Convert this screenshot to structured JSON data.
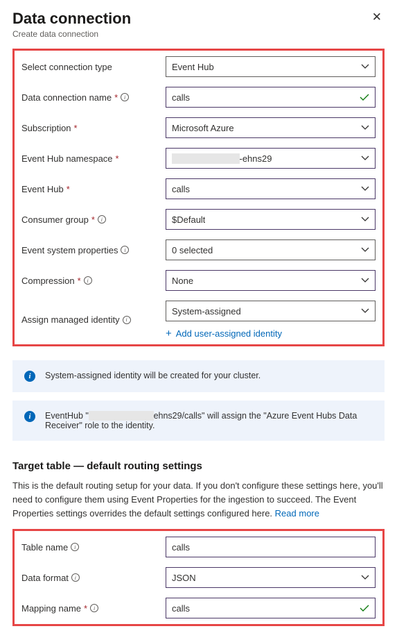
{
  "header": {
    "title": "Data connection",
    "subtitle": "Create data connection"
  },
  "form": {
    "connectionType": {
      "label": "Select connection type",
      "value": "Event Hub"
    },
    "connectionName": {
      "label": "Data connection name",
      "value": "calls"
    },
    "subscription": {
      "label": "Subscription",
      "value": "Microsoft Azure"
    },
    "namespace": {
      "label": "Event Hub namespace",
      "value_prefix": "",
      "value_suffix": "-ehns29"
    },
    "eventHub": {
      "label": "Event Hub",
      "value": "calls"
    },
    "consumerGroup": {
      "label": "Consumer group",
      "value": "$Default"
    },
    "systemProps": {
      "label": "Event system properties",
      "value": "0 selected"
    },
    "compression": {
      "label": "Compression",
      "value": "None"
    },
    "identity": {
      "label": "Assign managed identity",
      "value": "System-assigned"
    },
    "addIdentity": "Add user-assigned identity"
  },
  "banners": {
    "systemAssigned": "System-assigned identity will be created for your cluster.",
    "eventHubRole_prefix": "EventHub \"",
    "eventHubRole_middle": "ehns29/calls\" will assign the \"Azure Event Hubs Data Receiver\" role to the identity."
  },
  "target": {
    "title": "Target table — default routing settings",
    "desc": "This is the default routing setup for your data. If you don't configure these settings here, you'll need to configure them using Event Properties for the ingestion to succeed. The Event Properties settings overrides the default settings configured here. ",
    "readMore": "Read more",
    "tableName": {
      "label": "Table name",
      "value": "calls"
    },
    "dataFormat": {
      "label": "Data format",
      "value": "JSON"
    },
    "mappingName": {
      "label": "Mapping name",
      "value": "calls"
    }
  }
}
